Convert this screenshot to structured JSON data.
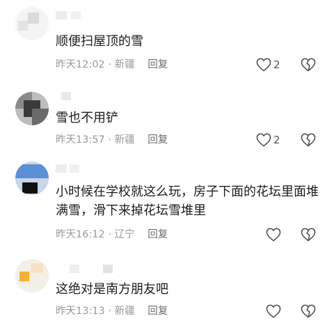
{
  "comments": [
    {
      "text": "顺便扫屋顶的雪",
      "time": "昨天12:02",
      "sep": "·",
      "location": "新疆",
      "reply_label": "回复",
      "like_count": "2",
      "avatar_colors": [
        "#f2f2f2",
        "#e6e6e6",
        "#dadada"
      ]
    },
    {
      "text": "雪也不用铲",
      "time": "昨天13:57",
      "sep": "·",
      "location": "新疆",
      "reply_label": "回复",
      "like_count": "2",
      "avatar_colors": [
        "#3a3a3a",
        "#888888",
        "#bdbdbd"
      ]
    },
    {
      "text": "小时候在学校就这么玩，房子下面的花坛里面堆满雪，滑下来掉花坛雪堆里",
      "time": "昨天16:12",
      "sep": "·",
      "location": "辽宁",
      "reply_label": "回复",
      "like_count": "",
      "avatar_colors": [
        "#5b8fd8",
        "#111111",
        "#c9d6e8"
      ]
    },
    {
      "text": "这绝对是南方朋友吧",
      "time": "昨天13:13",
      "sep": "·",
      "location": "新疆",
      "reply_label": "回复",
      "like_count": "",
      "avatar_colors": [
        "#f5b132",
        "#f7e3c2",
        "#e0e0e0"
      ]
    }
  ],
  "icons": {
    "like": "heart-outline-icon",
    "dislike": "broken-heart-outline-icon"
  },
  "colors": {
    "meta_gray": "#9a9a9a",
    "icon_gray": "#555555"
  }
}
